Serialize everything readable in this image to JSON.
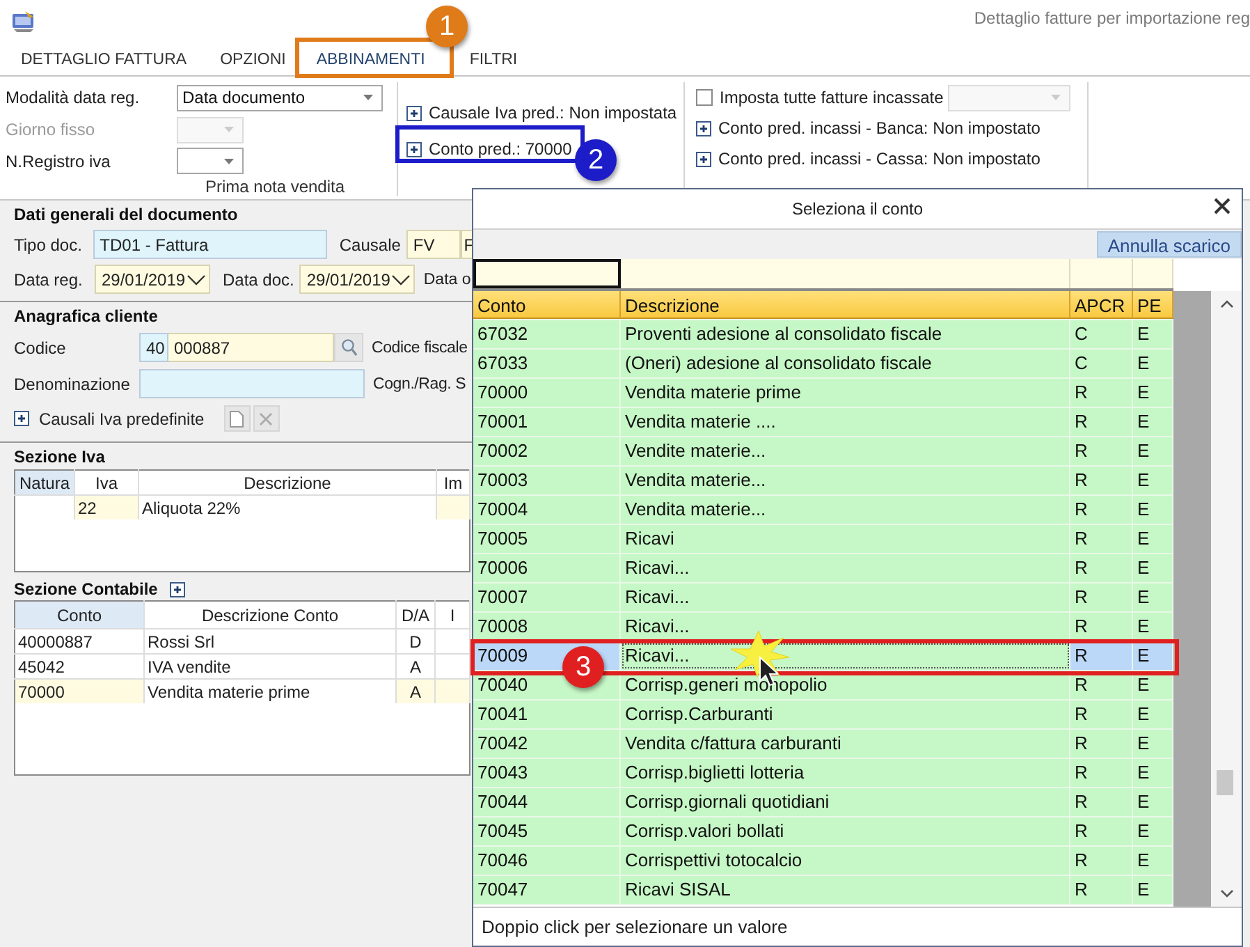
{
  "window": {
    "title": "Dettaglio fatture per importazione reg"
  },
  "tabs": [
    {
      "label": "DETTAGLIO FATTURA",
      "selected": false
    },
    {
      "label": "OPZIONI",
      "selected": false
    },
    {
      "label": "ABBINAMENTI",
      "selected": true
    },
    {
      "label": "FILTRI",
      "selected": false
    }
  ],
  "ribbon": {
    "registration": {
      "caption": "Prima nota vendita",
      "fields": [
        {
          "label": "Modalità data reg.",
          "value": "Data documento",
          "disabled": false,
          "kind": "wide"
        },
        {
          "label": "Giorno fisso",
          "disabled": true,
          "kind": "narrow"
        },
        {
          "label": "N.Registro iva",
          "disabled": false,
          "kind": "narrow"
        }
      ]
    },
    "defaults": [
      "Causale Iva pred.: Non impostata",
      "Conto pred.: 70000"
    ],
    "collections": {
      "checkbox": {
        "label": "Imposta tutte fatture incassate",
        "checked": false
      },
      "links": [
        "Conto pred. incassi - Banca: Non impostato",
        "Conto pred. incassi - Cassa: Non impostato"
      ]
    }
  },
  "document": {
    "title": "Dati generali del documento",
    "tipo_doc": {
      "label": "Tipo doc.",
      "value": "TD01 - Fattura"
    },
    "causale": {
      "label": "Causale",
      "code": "FV",
      "description": "F"
    },
    "data_reg": {
      "label": "Data reg.",
      "value": "29/01/2019"
    },
    "data_doc": {
      "label": "Data doc.",
      "value": "29/01/2019"
    },
    "data_other_label": "Data o"
  },
  "customer": {
    "title": "Anagrafica cliente",
    "codice": {
      "label": "Codice",
      "prefix": "40",
      "value": "000887"
    },
    "codice_fiscale_label": "Codice fiscale",
    "denominazione_label": "Denominazione",
    "ragione_sociale_label": "Cogn./Rag. S",
    "causali_label": "Causali Iva predefinite"
  },
  "iva_section": {
    "title": "Sezione Iva",
    "columns": [
      "Natura",
      "Iva",
      "Descrizione",
      "Im"
    ],
    "rows": [
      {
        "iva": "22",
        "descrizione": "Aliquota 22%"
      }
    ]
  },
  "accounting_section": {
    "title": "Sezione Contabile",
    "columns": [
      "Conto",
      "Descrizione Conto",
      "D/A",
      "I"
    ],
    "rows": [
      {
        "conto": "40000887",
        "descrizione": "Rossi Srl",
        "da": "D",
        "highlighted": false
      },
      {
        "conto": "45042",
        "descrizione": "IVA vendite",
        "da": "A",
        "highlighted": false
      },
      {
        "conto": "70000",
        "descrizione": "Vendita materie prime",
        "da": "A",
        "highlighted": true
      }
    ]
  },
  "picker": {
    "title": "Seleziona il conto",
    "action": "Annulla scarico",
    "columns": [
      "Conto",
      "Descrizione",
      "APCR",
      "PE"
    ],
    "hint": "Doppio click per selezionare un valore",
    "rows": [
      {
        "conto": "67032",
        "descrizione": "Proventi adesione al consolidato fiscale",
        "apcr": "C",
        "pe": "E",
        "selected": false
      },
      {
        "conto": "67033",
        "descrizione": "(Oneri) adesione al consolidato fiscale",
        "apcr": "C",
        "pe": "E",
        "selected": false
      },
      {
        "conto": "70000",
        "descrizione": "Vendita materie prime",
        "apcr": "R",
        "pe": "E",
        "selected": false
      },
      {
        "conto": "70001",
        "descrizione": "Vendita materie ....",
        "apcr": "R",
        "pe": "E",
        "selected": false
      },
      {
        "conto": "70002",
        "descrizione": "Vendite materie...",
        "apcr": "R",
        "pe": "E",
        "selected": false
      },
      {
        "conto": "70003",
        "descrizione": "Vendita materie...",
        "apcr": "R",
        "pe": "E",
        "selected": false
      },
      {
        "conto": "70004",
        "descrizione": "Vendita materie...",
        "apcr": "R",
        "pe": "E",
        "selected": false
      },
      {
        "conto": "70005",
        "descrizione": "Ricavi",
        "apcr": "R",
        "pe": "E",
        "selected": false
      },
      {
        "conto": "70006",
        "descrizione": "Ricavi...",
        "apcr": "R",
        "pe": "E",
        "selected": false
      },
      {
        "conto": "70007",
        "descrizione": "Ricavi...",
        "apcr": "R",
        "pe": "E",
        "selected": false
      },
      {
        "conto": "70008",
        "descrizione": "Ricavi...",
        "apcr": "R",
        "pe": "E",
        "selected": false
      },
      {
        "conto": "70009",
        "descrizione": "Ricavi...",
        "apcr": "R",
        "pe": "E",
        "selected": true
      },
      {
        "conto": "70040",
        "descrizione": "Corrisp.generi monopolio",
        "apcr": "R",
        "pe": "E",
        "selected": false
      },
      {
        "conto": "70041",
        "descrizione": "Corrisp.Carburanti",
        "apcr": "R",
        "pe": "E",
        "selected": false
      },
      {
        "conto": "70042",
        "descrizione": "Vendita c/fattura carburanti",
        "apcr": "R",
        "pe": "E",
        "selected": false
      },
      {
        "conto": "70043",
        "descrizione": "Corrisp.biglietti lotteria",
        "apcr": "R",
        "pe": "E",
        "selected": false
      },
      {
        "conto": "70044",
        "descrizione": "Corrisp.giornali quotidiani",
        "apcr": "R",
        "pe": "E",
        "selected": false
      },
      {
        "conto": "70045",
        "descrizione": "Corrisp.valori bollati",
        "apcr": "R",
        "pe": "E",
        "selected": false
      },
      {
        "conto": "70046",
        "descrizione": "Corrispettivi totocalcio",
        "apcr": "R",
        "pe": "E",
        "selected": false
      },
      {
        "conto": "70047",
        "descrizione": "Ricavi SISAL",
        "apcr": "R",
        "pe": "E",
        "selected": false
      }
    ]
  },
  "callouts": [
    {
      "number": "1",
      "color": "#e07b1a"
    },
    {
      "number": "2",
      "color": "#1c1cc8"
    },
    {
      "number": "3",
      "color": "#e02020"
    }
  ]
}
